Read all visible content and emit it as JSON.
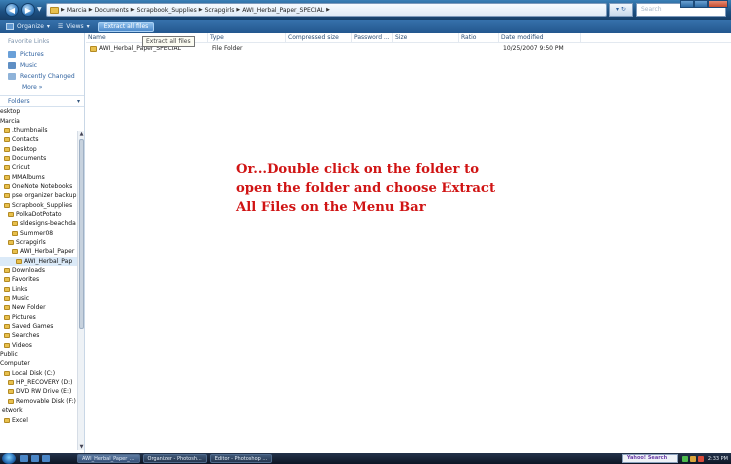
{
  "window": {
    "breadcrumbs": [
      "Marcia",
      "Documents",
      "Scrapbook_Supplies",
      "Scrapgirls",
      "AWI_Herbal_Paper_SPECIAL"
    ],
    "search_placeholder": "Search",
    "nav_back_icon": "back-arrow-icon",
    "nav_forward_icon": "forward-arrow-icon"
  },
  "toolbar": {
    "organize": "Organize",
    "views": "Views",
    "extract": "Extract all files"
  },
  "tooltip": "Extract all files",
  "left_pane": {
    "favorites_header": "Favorite Links",
    "favorites": [
      {
        "label": "Pictures",
        "icon": "pictures-icon"
      },
      {
        "label": "Music",
        "icon": "music-icon"
      },
      {
        "label": "Recently Changed",
        "icon": "recent-icon"
      }
    ],
    "more": "More »",
    "folders_header": "Folders",
    "tree": [
      "esktop",
      "Marcia",
      ".thumbnails",
      "Contacts",
      "Desktop",
      "Documents",
      "Cricut",
      "MMAlbums",
      "OneNote Notebooks",
      "pse organizer backup",
      "Scrapbook_Supplies",
      "PolkaDotPotato",
      "sldesigns-beachda",
      "Summer08",
      "Scrapgirls",
      "AWI_Herbal_Paper",
      "AWI_Herbal_Pap",
      "Downloads",
      "Favorites",
      "Links",
      "Music",
      "New Folder",
      "Pictures",
      "Saved Games",
      "Searches",
      "Videos",
      "Public",
      "Computer",
      "Local Disk (C:)",
      "HP_RECOVERY (D:)",
      "DVD RW Drive (E:)",
      "Removable Disk (F:)",
      "etwork",
      "Excel"
    ]
  },
  "columns": [
    "Name",
    "Type",
    "Compressed size",
    "Password ...",
    "Size",
    "Ratio",
    "Date modified"
  ],
  "rows": [
    {
      "name": "AWI_Herbal_Paper_SPECIAL",
      "type": "File Folder",
      "compressed": "",
      "password": "",
      "size": "",
      "ratio": "",
      "date": "10/25/2007 9:50 PM"
    }
  ],
  "annotation": "Or...Double click on the folder to open the folder and choose Extract All Files on the Menu Bar",
  "taskbar": {
    "tasks": [
      "AWI_Herbal_Paper_...",
      "Organizer - Photosh...",
      "Editor - Photoshop ..."
    ],
    "yahoo_search": "Yahoo! Search",
    "clock": "2:33 PM"
  },
  "colors": {
    "annotation": "#d01414",
    "link": "#2b5f9e",
    "titlebar": "#1d4f80"
  }
}
